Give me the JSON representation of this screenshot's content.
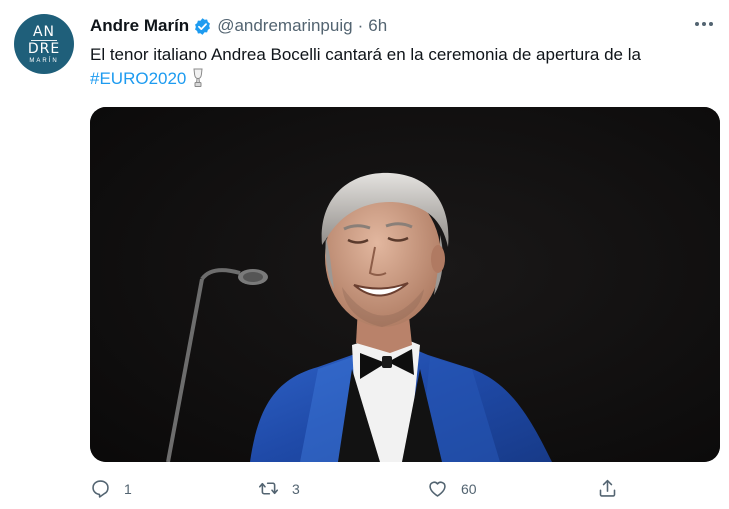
{
  "author": {
    "display_name": "Andre Marín",
    "handle": "@andremarinpuig",
    "separator": "·",
    "time": "6h",
    "avatar_text": [
      "AN",
      "DRE",
      "MARÍN"
    ],
    "verified": true
  },
  "tweet": {
    "text": "El tenor italiano Andrea Bocelli cantará en la ceremonia de apertura de la",
    "hashtag": "#EURO2020",
    "emoji": "trophy-icon"
  },
  "media": {
    "type": "photo",
    "description_icon": "photo"
  },
  "actions": {
    "reply_count": "1",
    "retweet_count": "3",
    "like_count": "60",
    "share_count": ""
  },
  "colors": {
    "accent": "#1d9bf0",
    "verified": "#1d9bf0",
    "avatar_bg": "#1f5f7a",
    "secondary_text": "#536471"
  },
  "icons": [
    "more-icon",
    "verified-badge-icon",
    "trophy-icon",
    "reply-icon",
    "retweet-icon",
    "like-icon",
    "share-icon"
  ]
}
